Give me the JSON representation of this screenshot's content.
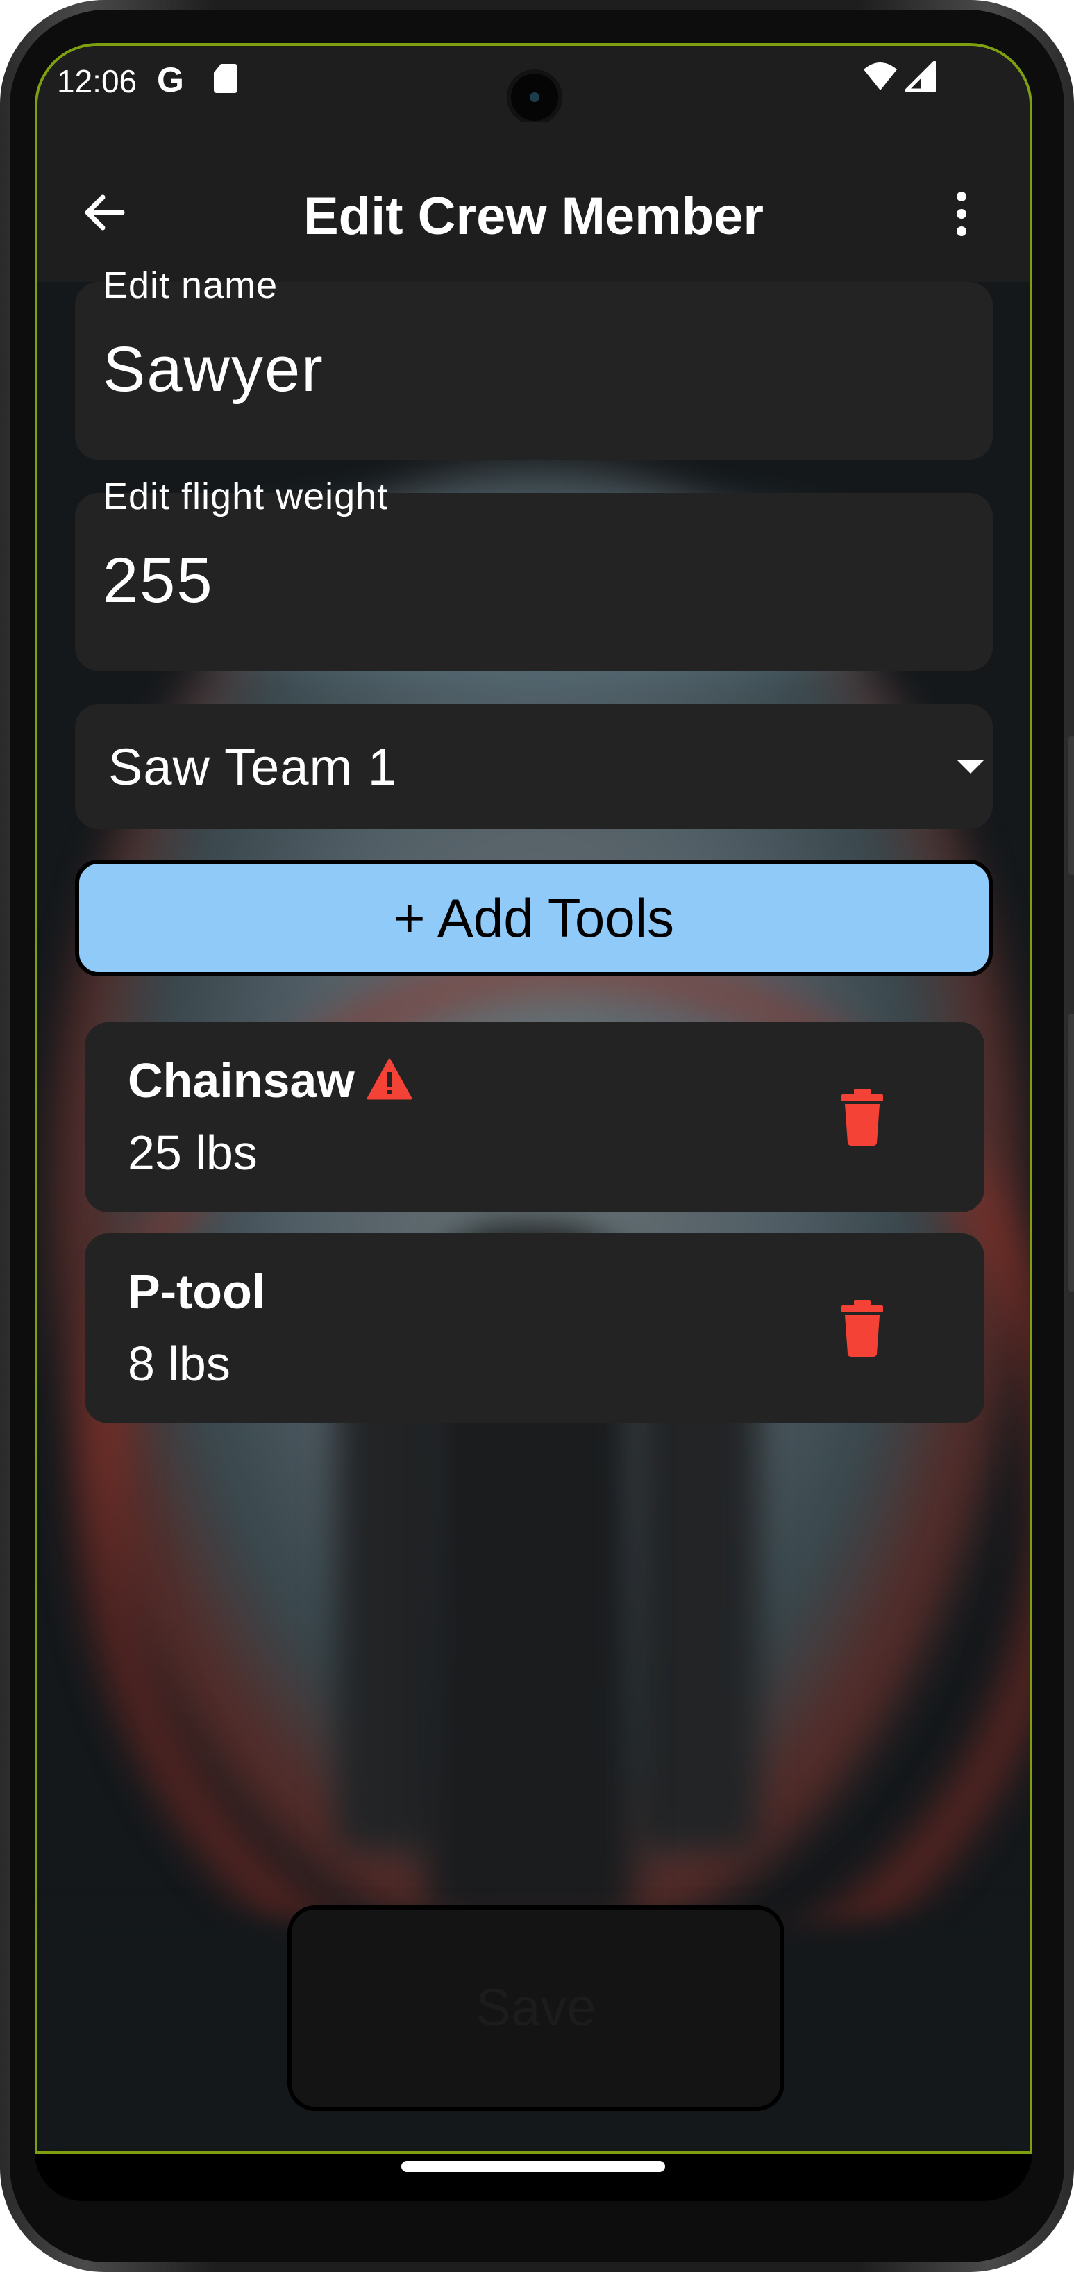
{
  "status_bar": {
    "time": "12:06",
    "google_glyph": "G",
    "icons": [
      "sd-card-icon",
      "wifi-icon",
      "signal-icon"
    ]
  },
  "app_bar": {
    "title": "Edit Crew Member",
    "back_icon": "arrow-left-icon",
    "menu_icon": "more-vert-icon"
  },
  "form": {
    "name": {
      "label": "Edit name",
      "value": "Sawyer"
    },
    "flight_weight": {
      "label": "Edit flight weight",
      "value": "255"
    },
    "position": {
      "selected": "Saw Team 1"
    },
    "add_tools_label": "+ Add Tools"
  },
  "tools": [
    {
      "name": "Chainsaw",
      "weight": "25 lbs",
      "warning": true
    },
    {
      "name": "P-tool",
      "weight": "8 lbs",
      "warning": false
    }
  ],
  "save_label": "Save",
  "colors": {
    "accent_button": "#90caf9",
    "danger": "#f44336",
    "surface": "#232323",
    "app_bar": "#1e1e1e",
    "debug_border": "#7ea010"
  }
}
